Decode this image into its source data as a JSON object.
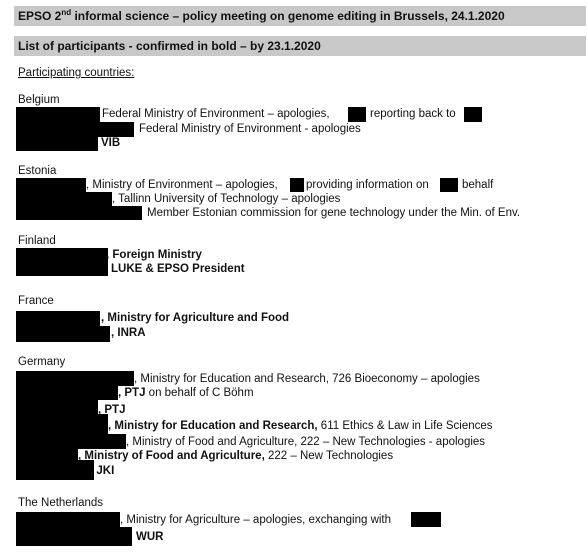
{
  "header": {
    "title_pre": "EPSO 2",
    "title_sup": "nd",
    "title_post": " informal science – policy meeting on genome editing in Brussels, 24.1.2020",
    "subtitle": "List of participants - confirmed in bold – by 23.1.2020"
  },
  "section_heading": "Participating countries:",
  "belgium": {
    "name": "Belgium",
    "l1a": "Federal Ministry of Environment – apologies,",
    "l1b": "reporting back to",
    "l2": "Federal Ministry of Environment - apologies",
    "l3": "VIB"
  },
  "estonia": {
    "name": "Estonia",
    "l1a": ", Ministry of Environment – apologies,",
    "l1b": "providing information on",
    "l1c": "behalf",
    "l2": ", Tallinn University of Technology – apologies",
    "l3": "Member Estonian commission for gene technology under the Min. of Env."
  },
  "finland": {
    "name": "Finland",
    "l1": ", Foreign Ministry",
    "l2": "LUKE & EPSO President"
  },
  "france": {
    "name": "France",
    "l1": ", Ministry for Agriculture and Food",
    "l2": ", INRA"
  },
  "germany": {
    "name": "Germany",
    "l1": ", Ministry for Education and Research, 726 Bioeconomy – apologies",
    "l2a": ", PTJ",
    "l2b": " on behalf of C Böhm",
    "l3": ", PTJ",
    "l4a": ", Ministry for Education and Research,",
    "l4b": " 611 Ethics & Law in Life Sciences",
    "l5": ", Ministry of Food and Agriculture, 222 – New Technologies - apologies",
    "l6a": ", Ministry of Food and Agriculture,",
    "l6b": " 222 – New Technologies",
    "l7": ", JKI"
  },
  "netherlands": {
    "name": "The Netherlands",
    "l1": ", Ministry for Agriculture – apologies, exchanging with",
    "l2": "WUR"
  }
}
